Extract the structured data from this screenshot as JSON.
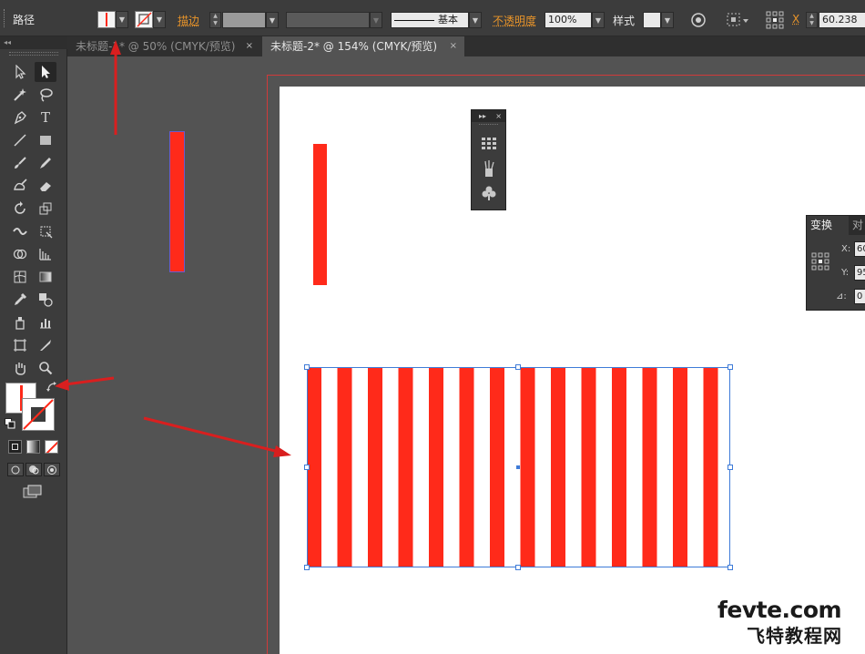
{
  "control_bar": {
    "object_type": "路径",
    "stroke_label": "描边",
    "stroke_style": "基本",
    "opacity_label": "不透明度",
    "opacity_value": "100%",
    "style_label": "样式",
    "x_label": "X",
    "x_value": "60.238"
  },
  "tabs": [
    {
      "label": "未标题-1* @ 50% (CMYK/预览)",
      "close": "×",
      "active": false
    },
    {
      "label": "未标题-2* @ 154% (CMYK/预览)",
      "close": "×",
      "active": true
    }
  ],
  "toolbox": {
    "collapse": "◂◂",
    "text_tool": "T"
  },
  "mini_panel": {
    "collapse": "▸▸",
    "close": "×"
  },
  "transform_panel": {
    "tab_active": "变换",
    "tab_other": "对",
    "x_label": "X:",
    "x_value": "60",
    "y_label": "Y:",
    "y_value": "95",
    "angle_label": "⊿:",
    "angle_value": "0"
  },
  "watermark": {
    "site": "fevte.com",
    "name": "飞特教程网"
  },
  "colors": {
    "accent_red": "#ff2a1a",
    "arrow_red": "#d91f1f",
    "selection_blue": "#3e7bd8",
    "artboard_edge": "#d03a3a"
  }
}
